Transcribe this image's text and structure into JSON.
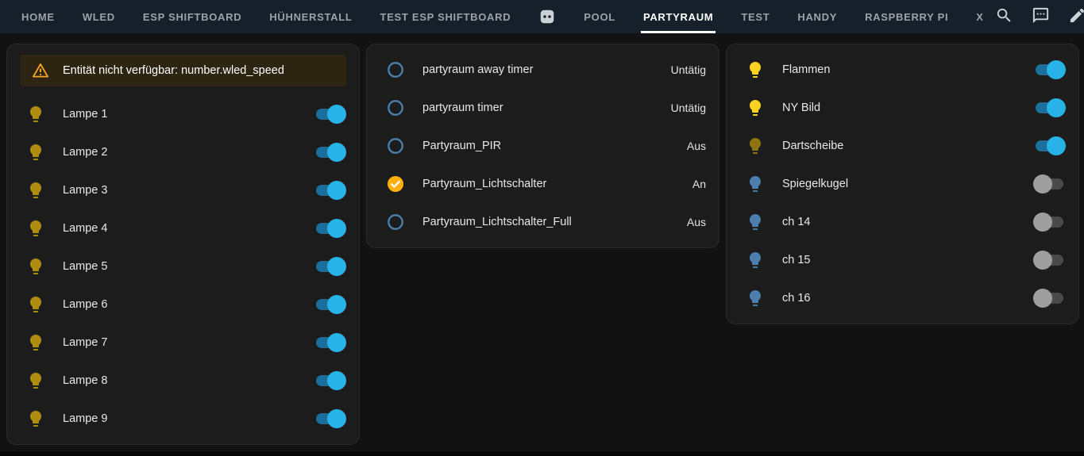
{
  "colors": {
    "header_bg": "#15202a",
    "page_bg": "#121212",
    "card_bg": "#1c1c1c",
    "tab_active": "#ffffff",
    "tab_inactive": "#9da2a6",
    "toggle_on_knob": "#29b2e8",
    "toggle_on_track": "#1b6f9c",
    "toggle_off_knob": "#9e9e9e",
    "toggle_off_track": "#4a4a4a",
    "warning_bg": "#2d2511",
    "warning_icon": "#f7a62a"
  },
  "header": {
    "tabs": [
      {
        "label": "HOME"
      },
      {
        "label": "WLED"
      },
      {
        "label": "ESP SHIFTBOARD"
      },
      {
        "label": "HÜHNERSTALL"
      },
      {
        "label": "TEST ESP SHIFTBOARD"
      },
      {
        "icon": "power-socket"
      },
      {
        "label": "POOL"
      },
      {
        "label": "PARTYRAUM",
        "active": true
      },
      {
        "label": "TEST"
      },
      {
        "label": "HANDY"
      },
      {
        "label": "RASPBERRY PI"
      },
      {
        "label": "X"
      }
    ],
    "actions": [
      {
        "icon": "search"
      },
      {
        "icon": "comment"
      },
      {
        "icon": "edit"
      }
    ]
  },
  "cards": [
    {
      "id": "wled-lamps",
      "warning": "Entität nicht verfügbar: number.wled_speed",
      "rows": [
        {
          "label": "Lampe 1",
          "icon": "lightbulb",
          "icon_color": "#b08c0e",
          "control": "toggle",
          "on": true
        },
        {
          "label": "Lampe 2",
          "icon": "lightbulb",
          "icon_color": "#b08c0e",
          "control": "toggle",
          "on": true
        },
        {
          "label": "Lampe 3",
          "icon": "lightbulb",
          "icon_color": "#b08c0e",
          "control": "toggle",
          "on": true
        },
        {
          "label": "Lampe 4",
          "icon": "lightbulb",
          "icon_color": "#b08c0e",
          "control": "toggle",
          "on": true
        },
        {
          "label": "Lampe 5",
          "icon": "lightbulb",
          "icon_color": "#b08c0e",
          "control": "toggle",
          "on": true
        },
        {
          "label": "Lampe 6",
          "icon": "lightbulb",
          "icon_color": "#b08c0e",
          "control": "toggle",
          "on": true
        },
        {
          "label": "Lampe 7",
          "icon": "lightbulb",
          "icon_color": "#b08c0e",
          "control": "toggle",
          "on": true
        },
        {
          "label": "Lampe 8",
          "icon": "lightbulb",
          "icon_color": "#b08c0e",
          "control": "toggle",
          "on": true
        },
        {
          "label": "Lampe 9",
          "icon": "lightbulb",
          "icon_color": "#b08c0e",
          "control": "toggle",
          "on": true
        }
      ]
    },
    {
      "id": "timers-switches",
      "rows": [
        {
          "label": "partyraum away timer",
          "icon": "circle-outline",
          "icon_color": "#4d7fae",
          "control": "state",
          "state": "Untätig"
        },
        {
          "label": "partyraum timer",
          "icon": "circle-outline",
          "icon_color": "#4d7fae",
          "control": "state",
          "state": "Untätig"
        },
        {
          "label": "Partyraum_PIR",
          "icon": "circle-outline",
          "icon_color": "#4d7fae",
          "control": "state",
          "state": "Aus"
        },
        {
          "label": "Partyraum_Lichtschalter",
          "icon": "check-circle",
          "icon_color": "#ffb10a",
          "control": "state",
          "state": "An"
        },
        {
          "label": "Partyraum_Lichtschalter_Full",
          "icon": "circle-outline",
          "icon_color": "#4d7fae",
          "control": "state",
          "state": "Aus"
        }
      ]
    },
    {
      "id": "party-lights",
      "rows": [
        {
          "label": "Flammen",
          "icon": "lightbulb",
          "icon_color": "#ffd21f",
          "control": "toggle",
          "on": true
        },
        {
          "label": "NY Bild",
          "icon": "lightbulb",
          "icon_color": "#ffd21f",
          "control": "toggle",
          "on": true
        },
        {
          "label": "Dartscheibe",
          "icon": "lightbulb",
          "icon_color": "#8d7410",
          "control": "toggle",
          "on": true
        },
        {
          "label": "Spiegelkugel",
          "icon": "lightbulb",
          "icon_color": "#4d7fae",
          "control": "toggle",
          "on": false
        },
        {
          "label": "ch 14",
          "icon": "lightbulb",
          "icon_color": "#4d7fae",
          "control": "toggle",
          "on": false
        },
        {
          "label": "ch 15",
          "icon": "lightbulb",
          "icon_color": "#4d7fae",
          "control": "toggle",
          "on": false
        },
        {
          "label": "ch 16",
          "icon": "lightbulb",
          "icon_color": "#4d7fae",
          "control": "toggle",
          "on": false
        }
      ]
    }
  ]
}
